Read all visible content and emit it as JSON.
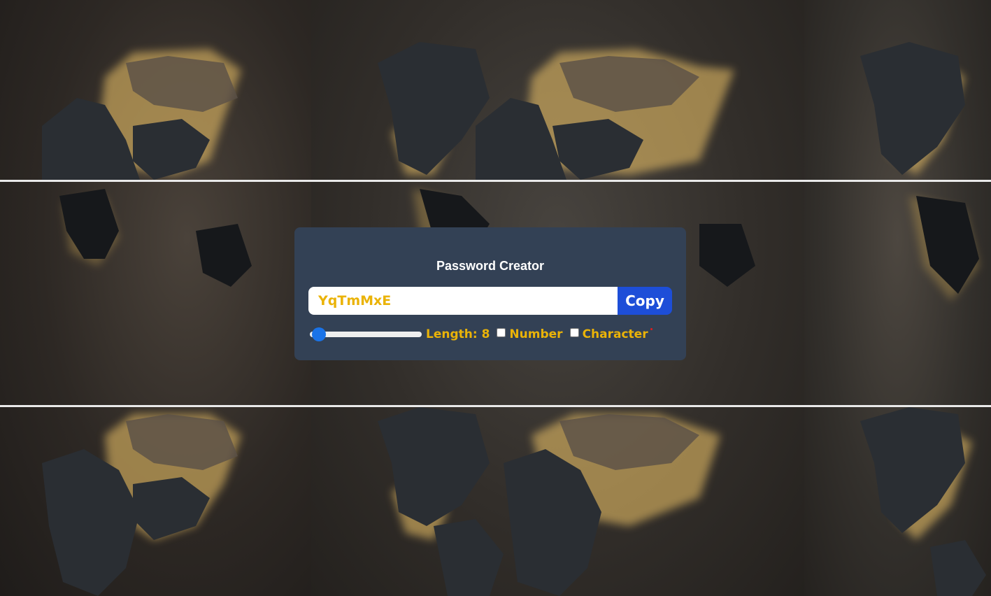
{
  "app": {
    "title": "Password Creator"
  },
  "password": {
    "value": "YqTmMxE",
    "placeholder": ""
  },
  "copy_button": {
    "label": "Copy"
  },
  "options": {
    "length_label": "Length: 8",
    "length_value": 8,
    "number_label": "Number",
    "number_checked": false,
    "character_label": "Character",
    "character_checked": false
  },
  "colors": {
    "card_background": "#334155",
    "accent_text": "#eab308",
    "copy_button": "#1d4ed8",
    "slider_thumb": "#1a73e8"
  },
  "icons": {
    "background": "world-map-wall-image"
  }
}
